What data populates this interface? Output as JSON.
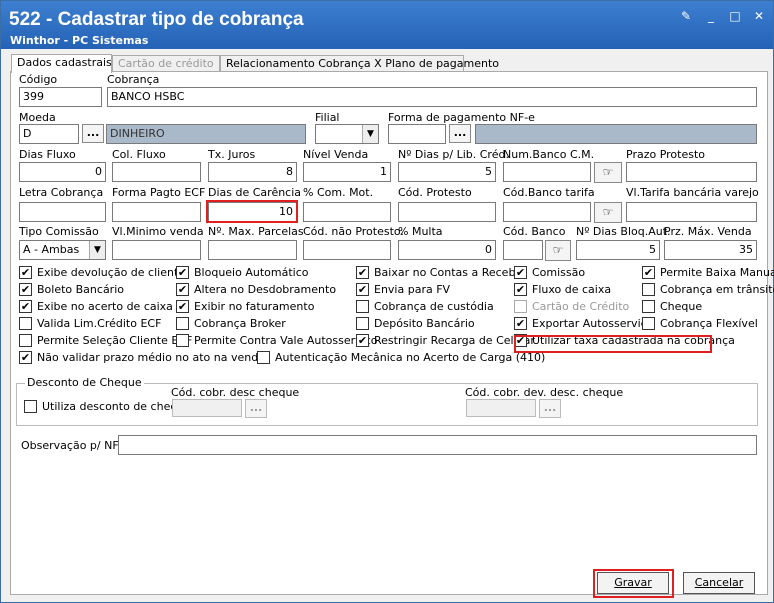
{
  "window": {
    "title": "522 - Cadastrar tipo de cobrança",
    "subtitle": "Winthor - PC Sistemas"
  },
  "tabs": [
    "Dados cadastrais",
    "Cartão de crédito",
    "Relacionamento Cobrança X Plano de pagamento"
  ],
  "fields": {
    "codigo_label": "Código",
    "codigo": "399",
    "cobranca_label": "Cobrança",
    "cobranca": "BANCO HSBC",
    "moeda_label": "Moeda",
    "moeda": "D",
    "moeda_desc": "DINHEIRO",
    "filial_label": "Filial",
    "fpag_label": "Forma de pagamento NF-e",
    "dias_fluxo_label": "Dias Fluxo",
    "dias_fluxo": "0",
    "col_fluxo_label": "Col. Fluxo",
    "tx_juros_label": "Tx. Juros",
    "tx_juros": "8",
    "nivel_venda_label": "Nível Venda",
    "nivel_venda": "1",
    "ndias_lib_label": "Nº Dias p/ Lib. Créd.",
    "ndias_lib": "5",
    "num_banco_label": "Num.Banco C.M.",
    "prazo_protesto_label": "Prazo Protesto",
    "letra_label": "Letra Cobrança",
    "forma_ecf_label": "Forma Pagto ECF",
    "dias_carencia_label": "Dias de Carência",
    "dias_carencia": "10",
    "com_mot_label": "% Com. Mot.",
    "cod_protesto_label": "Cód. Protesto",
    "cod_banco_tarifa_label": "Cód.Banco tarifa",
    "vl_tarifa_label": "Vl.Tarifa bancária varejo",
    "tipo_comissao_label": "Tipo Comissão",
    "tipo_comissao": "A - Ambas",
    "vl_minimo_label": "Vl.Minimo venda",
    "max_parcelas_label": "Nº. Max. Parcelas",
    "cod_nao_protesto_label": "Cód. não Protesto.",
    "multa_label": "% Multa",
    "multa": "0",
    "cod_banco_label": "Cód. Banco",
    "dias_bloq_label": "Nº Dias Bloq.Aut.",
    "dias_bloq": "5",
    "prz_max_label": "Prz. Máx. Venda",
    "prz_max": "35",
    "obs_label": "Observação p/ NF:"
  },
  "checkboxes": [
    {
      "label": "Exibe devolução de cliente",
      "checked": true
    },
    {
      "label": "Bloqueio Automático",
      "checked": true
    },
    {
      "label": "Baixar no Contas a Receber",
      "checked": true
    },
    {
      "label": "Comissão",
      "checked": true
    },
    {
      "label": "Permite Baixa Manual",
      "checked": true
    },
    {
      "label": "Boleto Bancário",
      "checked": true
    },
    {
      "label": "Altera no Desdobramento",
      "checked": true
    },
    {
      "label": "Envia para FV",
      "checked": true
    },
    {
      "label": "Fluxo de caixa",
      "checked": true
    },
    {
      "label": "Cobrança em trânsito",
      "checked": false
    },
    {
      "label": "Exibe no acerto de caixa",
      "checked": true
    },
    {
      "label": "Exibir no faturamento",
      "checked": true
    },
    {
      "label": "Cobrança de custódia",
      "checked": false
    },
    {
      "label": "Cartão de Crédito",
      "checked": false
    },
    {
      "label": "Cheque",
      "checked": false
    },
    {
      "label": "Valida Lim.Crédito ECF",
      "checked": false
    },
    {
      "label": "Cobrança Broker",
      "checked": false
    },
    {
      "label": "Depósito Bancário",
      "checked": false
    },
    {
      "label": "Exportar Autosserviço",
      "checked": true
    },
    {
      "label": "Cobrança Flexível",
      "checked": false
    },
    {
      "label": "Permite Seleção Cliente ECF",
      "checked": false
    },
    {
      "label": "Permite Contra Vale Autosserviço",
      "checked": false
    },
    {
      "label": "Restringir Recarga de Celular",
      "checked": true
    },
    {
      "label": "Utilizar taxa cadastrada na cobrança",
      "checked": true
    },
    {
      "label": "Não validar prazo médio no ato na venda",
      "checked": true
    },
    {
      "label": "Autenticação Mecânica no Acerto de Carga (410)",
      "checked": false
    }
  ],
  "cheque_group": {
    "title": "Desconto de Cheque",
    "cb": "Utiliza desconto de cheque",
    "desc_label": "Cód. cobr. desc cheque",
    "dev_label": "Cód. cobr. dev. desc. cheque"
  },
  "buttons": {
    "dots": "...",
    "gravar": "Gravar",
    "cancelar": "Cancelar"
  }
}
